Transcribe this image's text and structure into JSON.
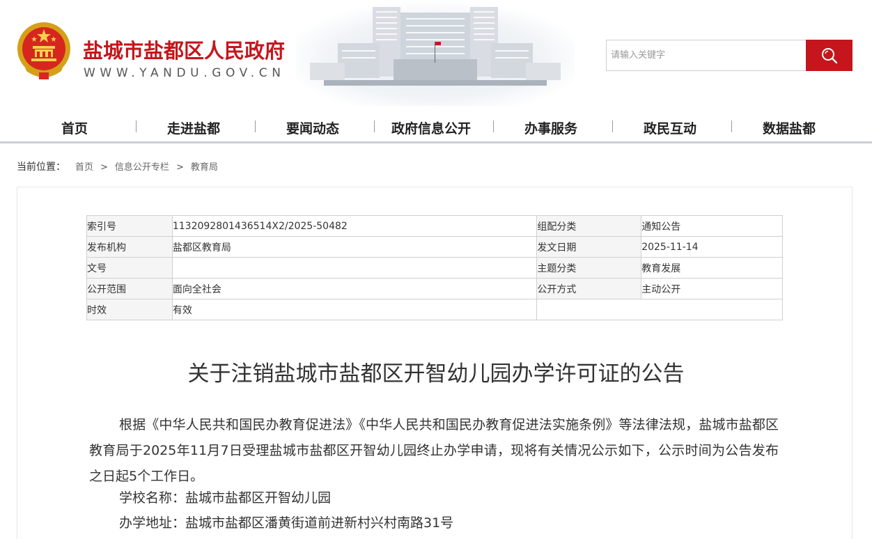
{
  "header": {
    "site_title": "盐城市盐都区人民政府",
    "site_url": "WWW.YANDU.GOV.CN",
    "search_placeholder": "请输入关键字"
  },
  "nav": {
    "items": [
      "首页",
      "走进盐都",
      "要闻动态",
      "政府信息公开",
      "办事服务",
      "政民互动",
      "数据盐都"
    ]
  },
  "breadcrumb": {
    "label": "当前位置：",
    "items": [
      "首页",
      "信息公开专栏",
      "教育局"
    ],
    "separator": ">"
  },
  "meta": {
    "rows": [
      {
        "k1": "索引号",
        "v1": "1132092801436514X2/2025-50482",
        "k2": "组配分类",
        "v2": "通知公告"
      },
      {
        "k1": "发布机构",
        "v1": "盐都区教育局",
        "k2": "发文日期",
        "v2": "2025-11-14"
      },
      {
        "k1": "文号",
        "v1": "",
        "k2": "主题分类",
        "v2": "教育发展"
      },
      {
        "k1": "公开范围",
        "v1": "面向全社会",
        "k2": "公开方式",
        "v2": "主动公开"
      },
      {
        "k1": "时效",
        "v1": "有效"
      }
    ]
  },
  "article": {
    "title": "关于注销盐城市盐都区开智幼儿园办学许可证的公告",
    "paragraph1": "根据《中华人民共和国民办教育促进法》《中华人民共和国民办教育促进法实施条例》等法律法规，盐城市盐都区教育局于2025年11月7日受理盐城市盐都区开智幼儿园终止办学申请，现将有关情况公示如下，公示时间为公告发布之日起5个工作日。",
    "school_name_line": "学校名称：盐城市盐都区开智幼儿园",
    "school_address_line": "办学地址：盐城市盐都区潘黄街道前进新村兴村南路31号"
  },
  "colors": {
    "brand_red": "#c4161c",
    "nav_border": "#c9cfd7"
  }
}
